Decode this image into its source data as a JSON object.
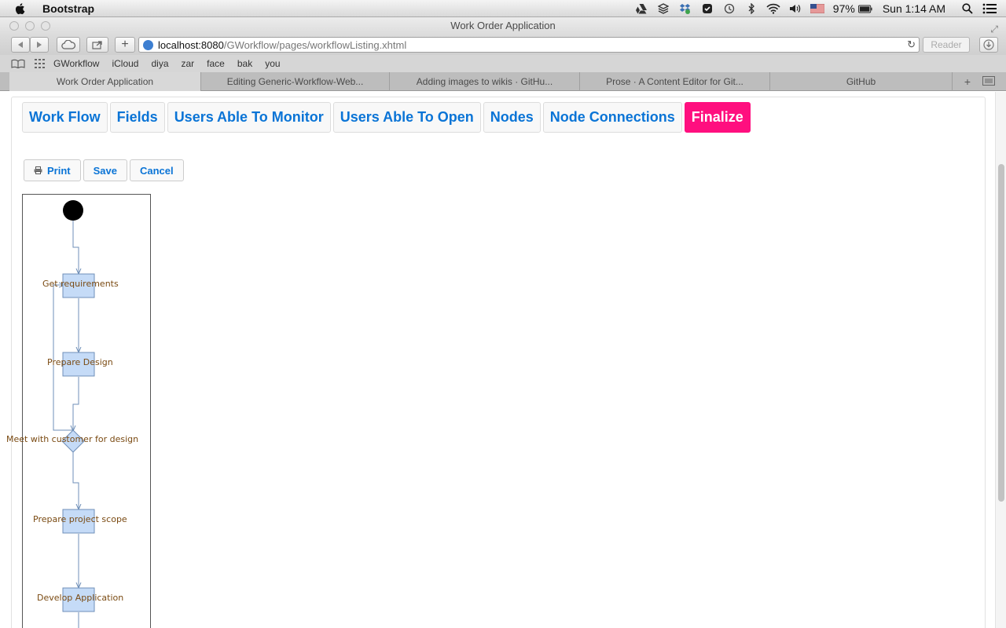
{
  "menubar": {
    "app_name": "Bootstrap",
    "battery": "97%",
    "clock": "Sun 1:14 AM"
  },
  "window": {
    "title": "Work Order Application"
  },
  "toolbar": {
    "url_host": "localhost:8080",
    "url_path": "/GWorkflow/pages/workflowListing.xhtml",
    "reader_label": "Reader"
  },
  "bookmarks": [
    "GWorkflow",
    "iCloud",
    "diya",
    "zar",
    "face",
    "bak",
    "you"
  ],
  "tabs": [
    "Work Order Application",
    "Editing Generic-Workflow-Web...",
    "Adding images to wikis · GitHu...",
    "Prose · A Content Editor for Git...",
    "GitHub"
  ],
  "nav": {
    "tabs": [
      "Work Flow",
      "Fields",
      "Users Able To Monitor",
      "Users Able To Open",
      "Nodes",
      "Node Connections",
      "Finalize"
    ],
    "active": "Finalize"
  },
  "actions": {
    "print": "Print",
    "save": "Save",
    "cancel": "Cancel"
  },
  "workflow": {
    "nodes": [
      "Get requirements",
      "Prepare Design",
      "Meet with customer for design",
      "Prepare project scope",
      "Develop Application"
    ]
  },
  "colors": {
    "link": "#0a74d6",
    "active_tab": "#ff0f7f",
    "node_fill": "#c5dbf7",
    "node_stroke": "#6f8fb8",
    "node_text": "#7a4a12"
  }
}
